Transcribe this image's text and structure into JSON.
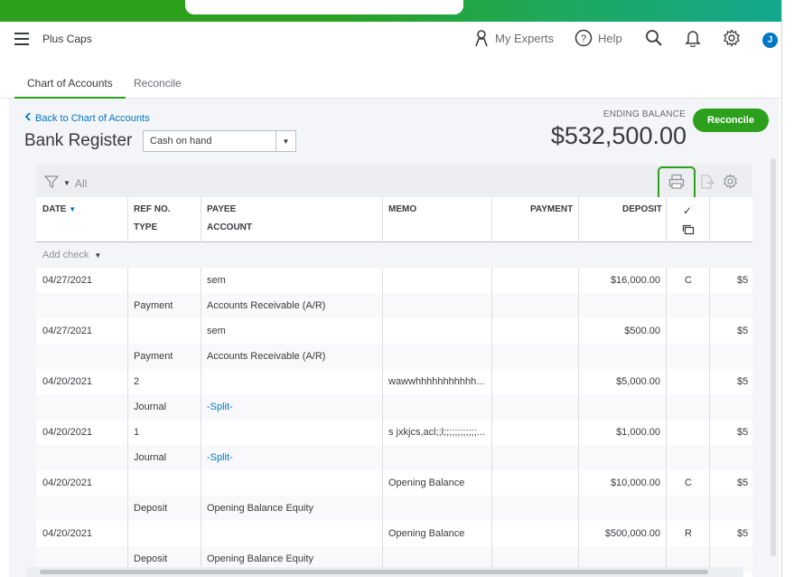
{
  "header": {
    "company": "Plus Caps",
    "my_experts": "My Experts",
    "help": "Help",
    "avatar_initial": "J"
  },
  "tabs": [
    {
      "label": "Chart of Accounts",
      "active": true
    },
    {
      "label": "Reconcile",
      "active": false
    }
  ],
  "register": {
    "back_link": "Back to Chart of Accounts",
    "title": "Bank Register",
    "account": "Cash on hand",
    "ending_label": "ENDING BALANCE",
    "ending_value": "$532,500.00",
    "reconcile_button": "Reconcile"
  },
  "toolbar": {
    "filter_label": "All"
  },
  "columns": {
    "date": "DATE",
    "ref_no": "REF NO.",
    "type": "TYPE",
    "payee": "PAYEE",
    "account": "ACCOUNT",
    "memo": "MEMO",
    "payment": "PAYMENT",
    "deposit": "DEPOSIT",
    "check": "✓"
  },
  "add_check": "Add check",
  "rows": [
    {
      "date": "04/27/2021",
      "ref": "",
      "type": "Payment",
      "payee": "sem",
      "account": "Accounts Receivable (A/R)",
      "memo": "",
      "payment": "",
      "deposit": "$16,000.00",
      "status": "C",
      "balance": "$5"
    },
    {
      "date": "04/27/2021",
      "ref": "",
      "type": "Payment",
      "payee": "sem",
      "account": "Accounts Receivable (A/R)",
      "memo": "",
      "payment": "",
      "deposit": "$500.00",
      "status": "",
      "balance": "$5"
    },
    {
      "date": "04/20/2021",
      "ref": "2",
      "type": "Journal",
      "payee": "",
      "account": "-Split-",
      "memo": "wawwhhhhhhhhhhh...",
      "payment": "",
      "deposit": "$5,000.00",
      "status": "",
      "balance": "$5"
    },
    {
      "date": "04/20/2021",
      "ref": "1",
      "type": "Journal",
      "payee": "",
      "account": "-Split-",
      "memo": "s jxkjcs,acl;;l;;;;;;;;;;;;...",
      "payment": "",
      "deposit": "$1,000.00",
      "status": "",
      "balance": "$5"
    },
    {
      "date": "04/20/2021",
      "ref": "",
      "type": "Deposit",
      "payee": "",
      "account": "Opening Balance Equity",
      "memo": "Opening Balance",
      "payment": "",
      "deposit": "$10,000.00",
      "status": "C",
      "balance": "$5"
    },
    {
      "date": "04/20/2021",
      "ref": "",
      "type": "Deposit",
      "payee": "",
      "account": "Opening Balance Equity",
      "memo": "Opening Balance",
      "payment": "",
      "deposit": "$500,000.00",
      "status": "R",
      "balance": "$5"
    }
  ],
  "colors": {
    "brand_green": "#2ca01c",
    "link_blue": "#0077c5"
  }
}
